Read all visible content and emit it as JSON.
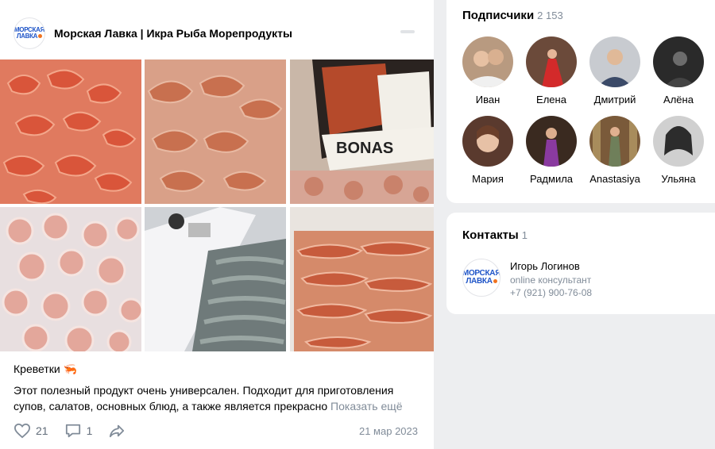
{
  "post": {
    "author": "Морская Лавка | Икра Рыба Морепродукты",
    "logo_line1": "МОРСКАЯ",
    "logo_line2": "ЛАВКА",
    "caption": "Креветки 🦐",
    "text": "Этот полезный продукт очень универсален. Подходит для приготовления супов, салатов, основных блюд, а также является прекрасно",
    "show_more": "Показать ещё",
    "likes": "21",
    "comments": "1",
    "date": "21 мар 2023",
    "photos": [
      "shrimp-pile-1",
      "shrimp-pile-2",
      "langostino-box",
      "frozen-shrimp-bag",
      "tiger-prawns-box",
      "langostino-tray"
    ]
  },
  "subscribers": {
    "title": "Подписчики",
    "count": "2 153",
    "people": [
      {
        "name": "Иван"
      },
      {
        "name": "Елена"
      },
      {
        "name": "Дмитрий"
      },
      {
        "name": "Алёна"
      },
      {
        "name": "Мария"
      },
      {
        "name": "Радмила"
      },
      {
        "name": "Anastasiya"
      },
      {
        "name": "Ульяна"
      }
    ]
  },
  "contacts": {
    "title": "Контакты",
    "count": "1",
    "name": "Игорь Логинов",
    "role": "online консультант",
    "phone": "+7 (921) 900-76-08"
  },
  "colors": {
    "accent_blue": "#1f55c8",
    "logo_orange": "#f0731f",
    "secondary_text": "#818c99",
    "page_bg": "#edeef0"
  }
}
